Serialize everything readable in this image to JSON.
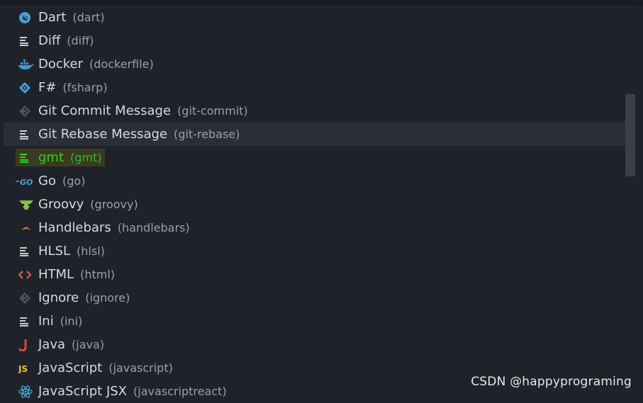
{
  "languages": [
    {
      "label": "Dart",
      "id": "(dart)",
      "icon": "dart-icon"
    },
    {
      "label": "Diff",
      "id": "(diff)",
      "icon": "lines-icon"
    },
    {
      "label": "Docker",
      "id": "(dockerfile)",
      "icon": "docker-icon"
    },
    {
      "label": "F#",
      "id": "(fsharp)",
      "icon": "fsharp-icon"
    },
    {
      "label": "Git Commit Message",
      "id": "(git-commit)",
      "icon": "git-icon"
    },
    {
      "label": "Git Rebase Message",
      "id": "(git-rebase)",
      "icon": "lines-icon"
    },
    {
      "label": "gmt",
      "id": "(gmt)",
      "icon": "lines-icon"
    },
    {
      "label": "Go",
      "id": "(go)",
      "icon": "go-icon"
    },
    {
      "label": "Groovy",
      "id": "(groovy)",
      "icon": "groovy-icon"
    },
    {
      "label": "Handlebars",
      "id": "(handlebars)",
      "icon": "handlebars-icon"
    },
    {
      "label": "HLSL",
      "id": "(hlsl)",
      "icon": "lines-icon"
    },
    {
      "label": "HTML",
      "id": "(html)",
      "icon": "html-icon"
    },
    {
      "label": "Ignore",
      "id": "(ignore)",
      "icon": "git-icon"
    },
    {
      "label": "Ini",
      "id": "(ini)",
      "icon": "lines-icon"
    },
    {
      "label": "Java",
      "id": "(java)",
      "icon": "java-icon"
    },
    {
      "label": "JavaScript",
      "id": "(javascript)",
      "icon": "javascript-icon"
    },
    {
      "label": "JavaScript JSX",
      "id": "(javascriptreact)",
      "icon": "react-icon"
    }
  ],
  "focused_index": 5,
  "highlighted_index": 6,
  "watermark": "CSDN @happyprograming",
  "colors": {
    "background": "#1f2329",
    "focused_row": "#2a2f36",
    "highlight_text": "#2fd12f",
    "highlight_bg": "#3a3a1e"
  }
}
